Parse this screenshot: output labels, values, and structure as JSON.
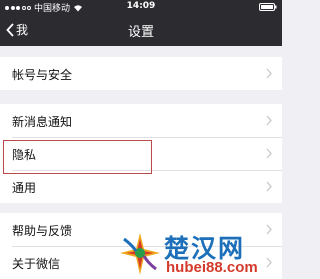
{
  "status_bar": {
    "carrier": "中国移动",
    "time": "14:09"
  },
  "nav": {
    "back_label": "我",
    "title": "设置"
  },
  "groups": [
    {
      "items": [
        {
          "label": "帐号与安全"
        }
      ]
    },
    {
      "items": [
        {
          "label": "新消息通知"
        },
        {
          "label": "隐私"
        },
        {
          "label": "通用"
        }
      ]
    },
    {
      "items": [
        {
          "label": "帮助与反馈"
        },
        {
          "label": "关于微信"
        }
      ]
    }
  ],
  "highlight": {
    "target": "隐私",
    "color": "#b84a4a"
  },
  "watermark": {
    "text": "楚汉网",
    "url": "hubei88.com"
  },
  "colors": {
    "nav_background": "#2b2b30",
    "page_background": "#efeff4",
    "watermark_blue": "#1c6fb8",
    "watermark_red": "#d43a2a"
  },
  "icons": [
    "signal-dots-icon",
    "wifi-icon",
    "battery-icon",
    "back-chevron-icon",
    "chevron-right-icon",
    "watermark-logo-icon"
  ]
}
